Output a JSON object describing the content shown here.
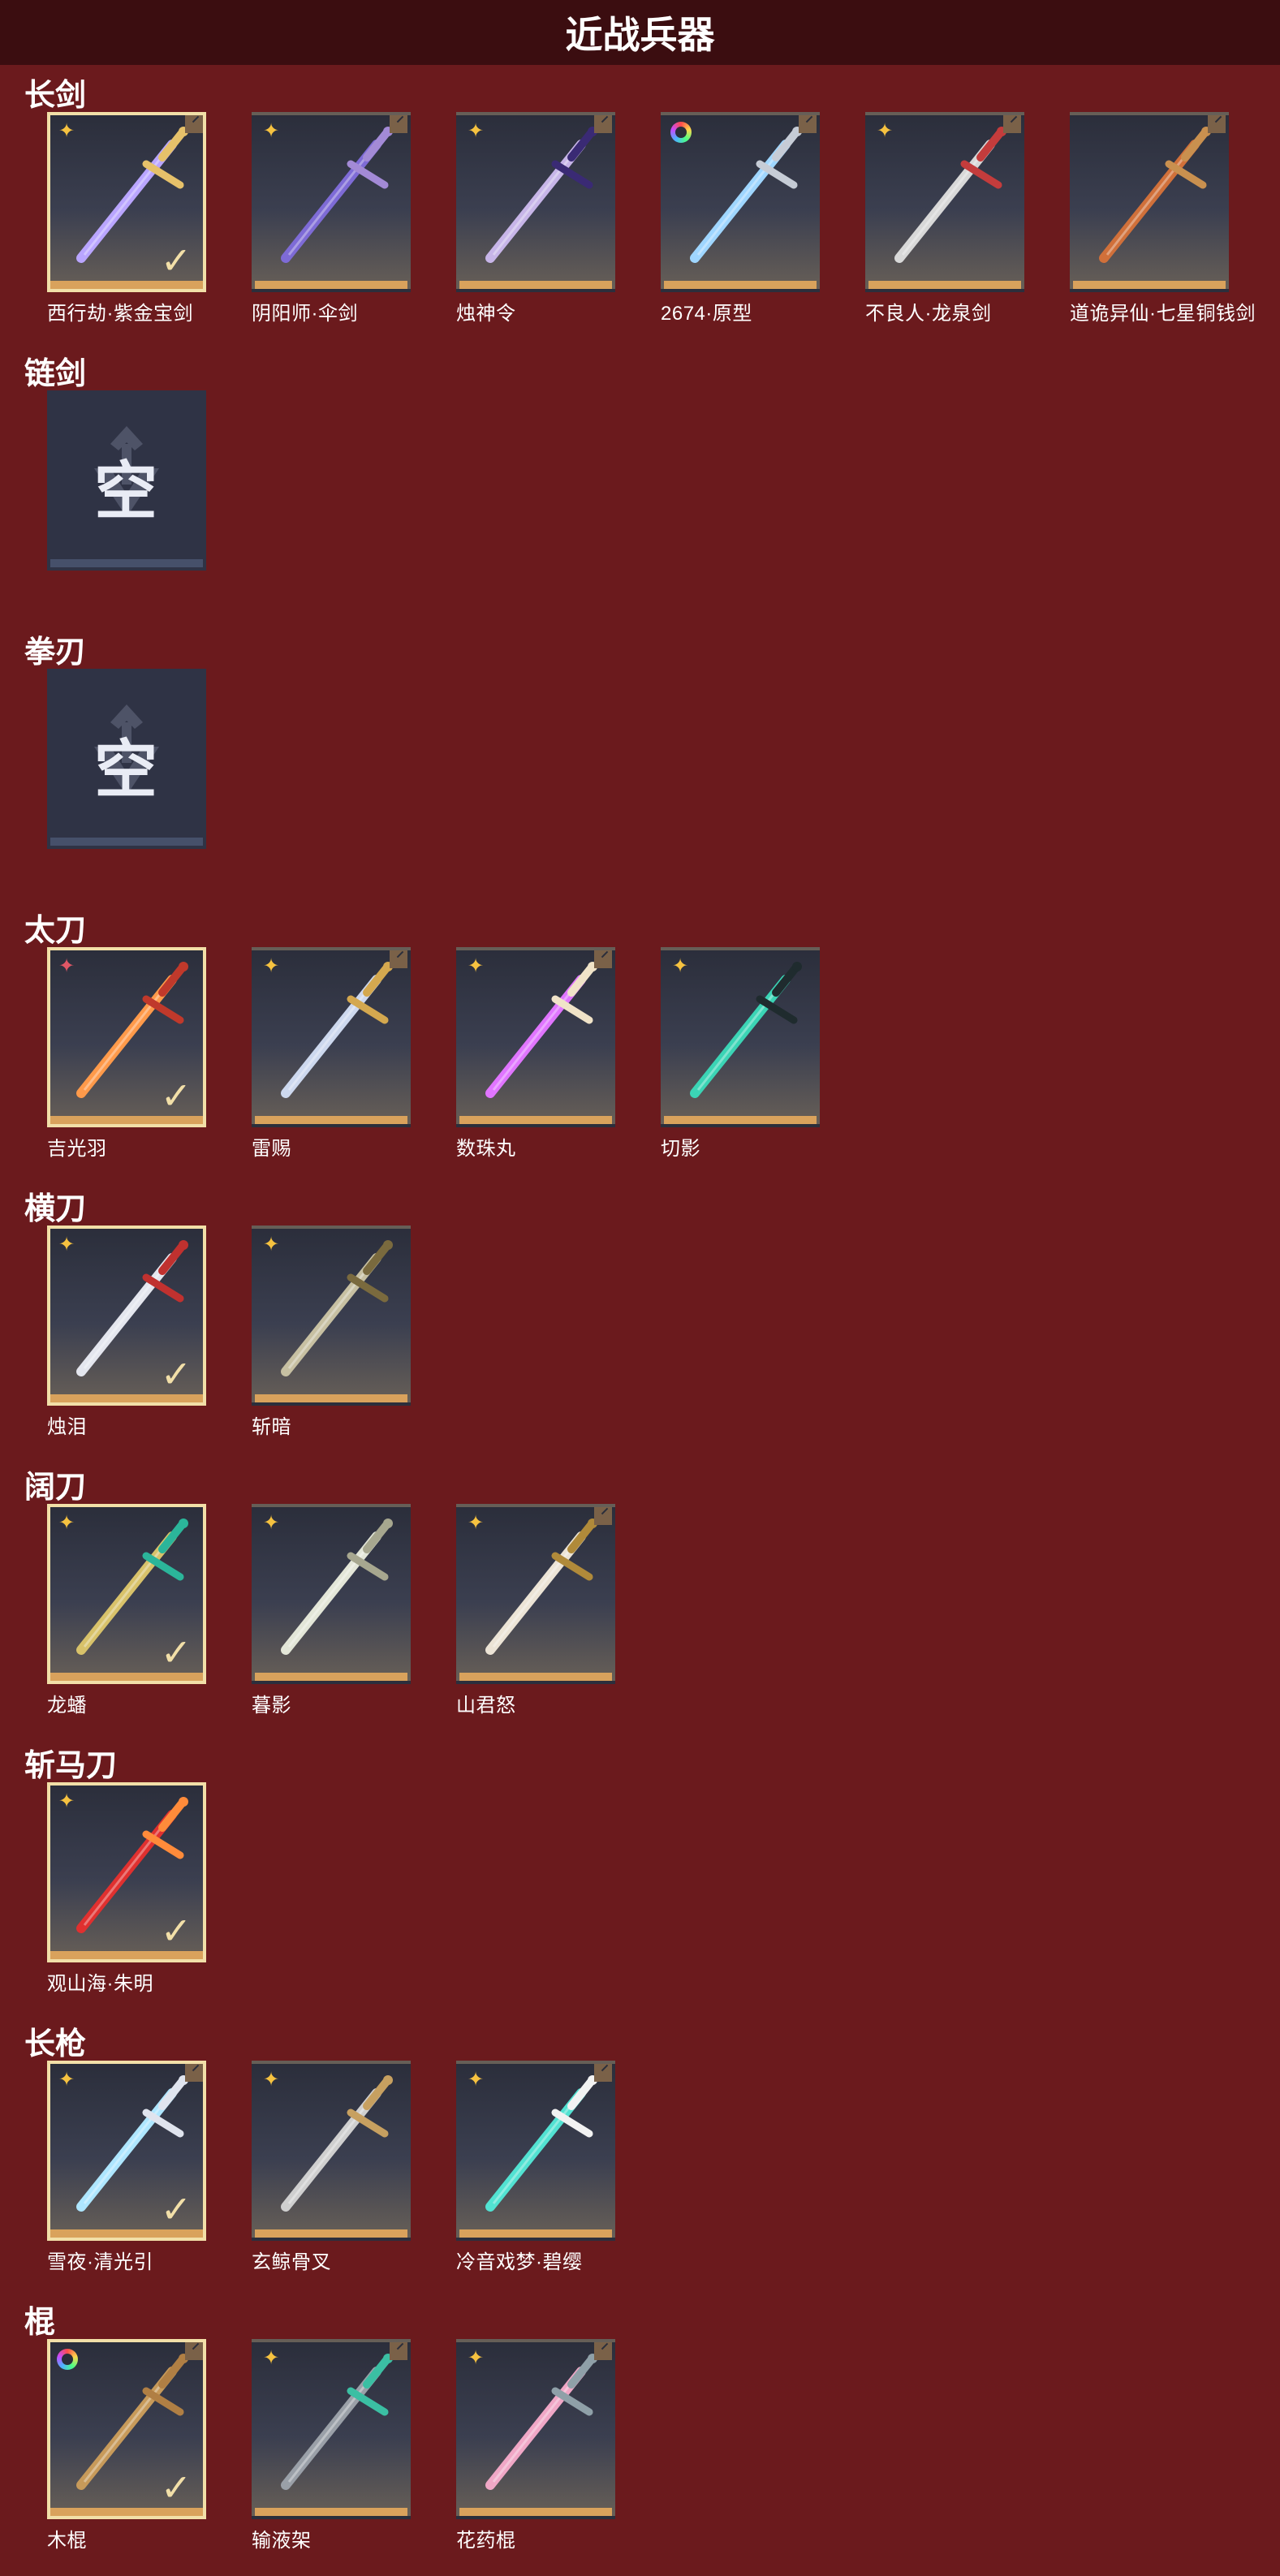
{
  "title": "近战兵器",
  "icons": {
    "rarity_star": "four-point-star-icon",
    "rarity_ring": "color-wheel-icon",
    "selected": "checkmark-icon",
    "empty": "empty-slot-emblem-icon"
  },
  "colors": {
    "background": "#6b1a1d",
    "topbar": "#3b0d10",
    "card_bottom": "#d9a25c",
    "selected_border": "#f2dfa8",
    "rarity_gold": "#f6c240",
    "rarity_red": "#e05766"
  },
  "empty_text": "空",
  "sections": [
    {
      "name": "长剑",
      "items": [
        {
          "label": "西行劫·紫金宝剑",
          "selected": true,
          "rarity": "star",
          "corner": true,
          "blade": "#b9a5ff",
          "hilt": "#e6c16a"
        },
        {
          "label": "阴阳师·伞剑",
          "selected": false,
          "rarity": "star",
          "corner": true,
          "blade": "#7e6bd6",
          "hilt": "#a38ad6"
        },
        {
          "label": "烛神令",
          "selected": false,
          "rarity": "star",
          "corner": true,
          "blade": "#c7b5e8",
          "hilt": "#3a2a74"
        },
        {
          "label": "2674·原型",
          "selected": false,
          "rarity": "ring",
          "corner": true,
          "blade": "#9fd6ff",
          "hilt": "#c6ccd6"
        },
        {
          "label": "不良人·龙泉剑",
          "selected": false,
          "rarity": "star",
          "corner": true,
          "blade": "#d8d8d8",
          "hilt": "#c43c3c"
        },
        {
          "label": "道诡异仙·七星铜钱剑",
          "selected": false,
          "rarity": "none",
          "corner": true,
          "blade": "#d0703a",
          "hilt": "#c9904f"
        }
      ]
    },
    {
      "name": "链剑",
      "items": [
        {
          "label": "",
          "empty": true
        }
      ]
    },
    {
      "name": "拳刃",
      "items": [
        {
          "label": "",
          "empty": true
        }
      ]
    },
    {
      "name": "太刀",
      "items": [
        {
          "label": "吉光羽",
          "selected": true,
          "rarity": "red",
          "corner": false,
          "blade": "#ff9a4a",
          "hilt": "#c0392b"
        },
        {
          "label": "雷赐",
          "selected": false,
          "rarity": "star",
          "corner": true,
          "blade": "#cdd8ee",
          "hilt": "#d4a84f"
        },
        {
          "label": "数珠丸",
          "selected": false,
          "rarity": "star",
          "corner": true,
          "blade": "#e075ff",
          "hilt": "#f0e3c8"
        },
        {
          "label": "切影",
          "selected": false,
          "rarity": "star",
          "corner": false,
          "blade": "#3bd4b5",
          "hilt": "#1f2b2e"
        }
      ]
    },
    {
      "name": "横刀",
      "items": [
        {
          "label": "烛泪",
          "selected": true,
          "rarity": "star",
          "corner": false,
          "blade": "#e4e6ee",
          "hilt": "#c0312f"
        },
        {
          "label": "斩暗",
          "selected": false,
          "rarity": "star",
          "corner": false,
          "blade": "#c7c0a2",
          "hilt": "#7a6a3e"
        }
      ]
    },
    {
      "name": "阔刀",
      "items": [
        {
          "label": "龙蟠",
          "selected": true,
          "rarity": "star",
          "corner": false,
          "blade": "#d8c26a",
          "hilt": "#2bb59a"
        },
        {
          "label": "暮影",
          "selected": false,
          "rarity": "star",
          "corner": false,
          "blade": "#e3e6d8",
          "hilt": "#a7a78f"
        },
        {
          "label": "山君怒",
          "selected": false,
          "rarity": "star",
          "corner": true,
          "blade": "#ece4d6",
          "hilt": "#b08a3a"
        }
      ]
    },
    {
      "name": "斩马刀",
      "items": [
        {
          "label": "观山海·朱明",
          "selected": true,
          "rarity": "star",
          "corner": false,
          "blade": "#e0302f",
          "hilt": "#ff8b3a"
        }
      ]
    },
    {
      "name": "长枪",
      "items": [
        {
          "label": "雪夜·清光引",
          "selected": true,
          "rarity": "star",
          "corner": true,
          "blade": "#aee6ff",
          "hilt": "#e0e4ee"
        },
        {
          "label": "玄鲸骨叉",
          "selected": false,
          "rarity": "star",
          "corner": false,
          "blade": "#cfcfcf",
          "hilt": "#c7a060"
        },
        {
          "label": "冷音戏梦·碧缨",
          "selected": false,
          "rarity": "star",
          "corner": true,
          "blade": "#52e2d2",
          "hilt": "#f2f2f2"
        }
      ]
    },
    {
      "name": "棍",
      "items": [
        {
          "label": "木棍",
          "selected": true,
          "rarity": "ring",
          "corner": true,
          "blade": "#c79a5a",
          "hilt": "#b07f44"
        },
        {
          "label": "输液架",
          "selected": false,
          "rarity": "star",
          "corner": true,
          "blade": "#9aa0a8",
          "hilt": "#3bbfa3"
        },
        {
          "label": "花药棍",
          "selected": false,
          "rarity": "star",
          "corner": true,
          "blade": "#f0a7c6",
          "hilt": "#8fa0a8"
        }
      ]
    }
  ]
}
